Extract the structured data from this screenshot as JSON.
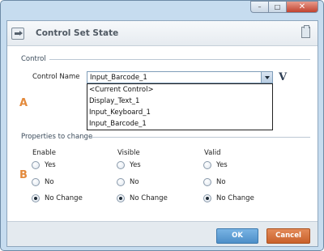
{
  "window": {
    "minimize_glyph": "–",
    "maximize_glyph": "□",
    "close_glyph": "✕"
  },
  "dialog": {
    "title": "Control Set State"
  },
  "control_section": {
    "heading": "Control",
    "field_label": "Control Name",
    "selected_value": "Input_Barcode_1",
    "options": [
      "<Current Control>",
      "Display_Text_1",
      "Input_Keyboard_1",
      "Input_Barcode_1"
    ],
    "variable_button_label": "V"
  },
  "markers": {
    "a": "A",
    "b": "B"
  },
  "properties_section": {
    "heading": "Properties to change",
    "columns": [
      {
        "name": "Enable",
        "options": [
          "Yes",
          "No",
          "No Change"
        ],
        "selected": "No Change"
      },
      {
        "name": "Visible",
        "options": [
          "Yes",
          "No",
          "No Change"
        ],
        "selected": "No Change"
      },
      {
        "name": "Valid",
        "options": [
          "Yes",
          "No",
          "No Change"
        ],
        "selected": "No Change"
      }
    ]
  },
  "footer": {
    "ok_label": "OK",
    "cancel_label": "Cancel"
  },
  "colors": {
    "marker": "#e38a3c",
    "ok_button": "#5b9bd5",
    "cancel_button": "#d4723c",
    "window_frame": "#c6dcef"
  }
}
